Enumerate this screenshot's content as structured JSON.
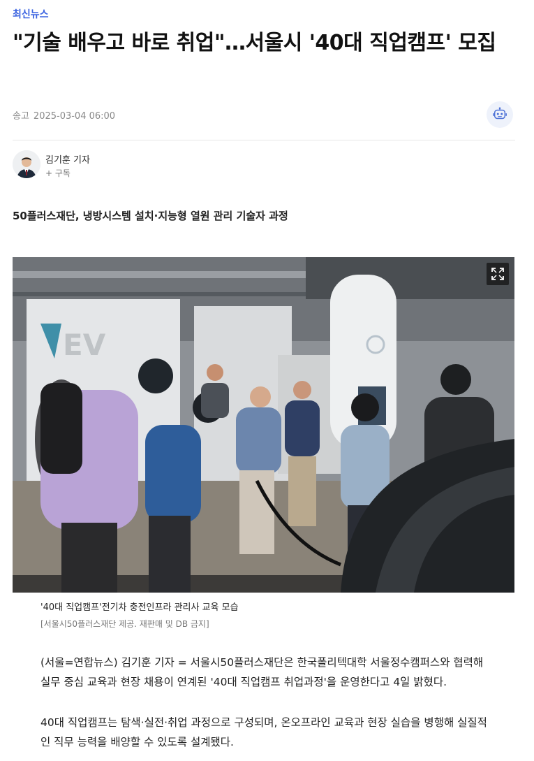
{
  "category": "최신뉴스",
  "headline": "\"기술 배우고 바로 취업\"…서울시 '40대 직업캠프' 모집",
  "dateline": {
    "label": "송고",
    "datetime": "2025-03-04 06:00"
  },
  "ai_button_icon": "robot-icon",
  "reporter": {
    "name": "김기훈 기자",
    "subscribe": "+ 구독"
  },
  "subheadline": "50플러스재단, 냉방시스템 설치·지능형 열원 관리 기술자 과정",
  "photo": {
    "expand_icon": "expand-icon",
    "caption": "'40대 직업캠프'전기차 충전인프라 관리사 교육 모습",
    "credit": "[서울시50플러스재단 제공. 재판매 및 DB 금지]",
    "logo_text": "EV"
  },
  "body": [
    "(서울=연합뉴스) 김기훈 기자 = 서울시50플러스재단은 한국폴리텍대학 서울정수캠퍼스와 협력해 실무 중심 교육과 현장 채용이 연계된 '40대 직업캠프 취업과정'을 운영한다고 4일 밝혔다.",
    "40대 직업캠프는 탐색·실전·취업 과정으로 구성되며, 온오프라인 교육과 현장 실습을 병행해 실질적인 직무 능력을 배양할 수 있도록 설계됐다."
  ],
  "colors": {
    "accent": "#3b63e0",
    "text": "#222222",
    "muted": "#888888"
  }
}
